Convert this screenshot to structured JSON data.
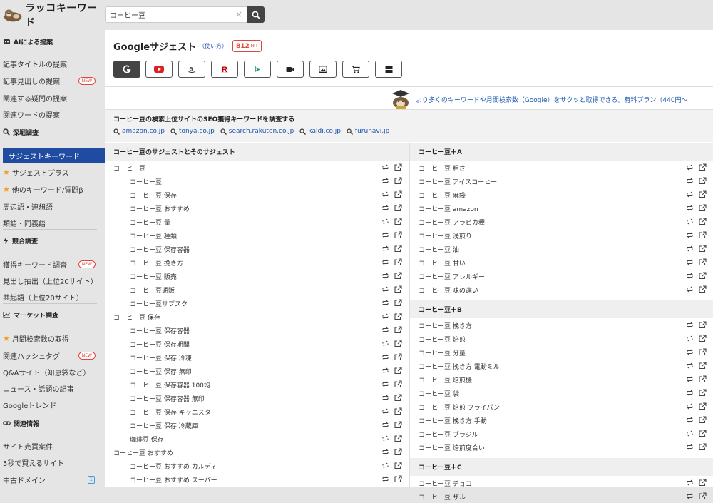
{
  "app": {
    "name": "ラッコキーワード"
  },
  "search": {
    "value": "コーヒー豆"
  },
  "sidebar": {
    "sections": [
      {
        "title": "AIによる提案",
        "icon": "robot-icon",
        "items": [
          {
            "label": "記事タイトルの提案"
          },
          {
            "label": "記事見出しの提案",
            "badge": "NEW"
          },
          {
            "label": "関連する疑問の提案"
          },
          {
            "label": "関連ワードの提案"
          }
        ]
      },
      {
        "title": "深堀調査",
        "icon": "search-icon",
        "items": [
          {
            "label": "サジェストキーワード",
            "active": true
          },
          {
            "label": "サジェストプラス",
            "star": true
          },
          {
            "label": "他のキーワード/質問β",
            "star": true
          },
          {
            "label": "周辺語・連想語"
          },
          {
            "label": "類語・同義語"
          }
        ]
      },
      {
        "title": "競合調査",
        "icon": "bolt-icon",
        "items": [
          {
            "label": "獲得キーワード調査",
            "badge": "NEW"
          },
          {
            "label": "見出し抽出（上位20サイト）"
          },
          {
            "label": "共起語（上位20サイト）"
          }
        ]
      },
      {
        "title": "マーケット調査",
        "icon": "chart-icon",
        "items": [
          {
            "label": "月間検索数の取得",
            "star": true
          },
          {
            "label": "関連ハッシュタグ",
            "badge": "NEW"
          },
          {
            "label": "Q&Aサイト（知恵袋など）"
          },
          {
            "label": "ニュース・話題の記事"
          },
          {
            "label": "Googleトレンド"
          }
        ]
      },
      {
        "title": "関連情報",
        "icon": "link-icon",
        "items": [
          {
            "label": "サイト売買案件"
          },
          {
            "label": "5秒で買えるサイト"
          },
          {
            "label": "中古ドメイン",
            "badge1": "1"
          }
        ]
      }
    ]
  },
  "main": {
    "title": "Googleサジェスト",
    "howto": "（使い方）",
    "hit_count": "812",
    "hit_unit": "HIT",
    "engines": [
      "google-icon",
      "youtube-icon",
      "amazon-icon",
      "rakuten-icon",
      "bing-icon",
      "video-icon",
      "image-icon",
      "shopping-icon",
      "news-icon"
    ],
    "promo": "より多くのキーワードや月間検索数（Google）をサクッと取得できる。有料プラン（440円〜",
    "seo_title": "コーヒー豆の検索上位サイトのSEO獲得キーワードを調査する",
    "seo_links": [
      "amazon.co.jp",
      "tonya.co.jp",
      "search.rakuten.co.jp",
      "kaldi.co.jp",
      "furunavi.jp"
    ],
    "left_header": "コーヒー豆のサジェストとそのサジェスト",
    "left_rows": [
      {
        "t": "コーヒー豆",
        "lvl": 0
      },
      {
        "t": "コーヒー豆",
        "lvl": 1
      },
      {
        "t": "コーヒー豆 保存",
        "lvl": 1
      },
      {
        "t": "コーヒー豆 おすすめ",
        "lvl": 1
      },
      {
        "t": "コーヒー豆 量",
        "lvl": 1
      },
      {
        "t": "コーヒー豆 種類",
        "lvl": 1
      },
      {
        "t": "コーヒー豆 保存容器",
        "lvl": 1
      },
      {
        "t": "コーヒー豆 挽き方",
        "lvl": 1
      },
      {
        "t": "コーヒー豆 販売",
        "lvl": 1
      },
      {
        "t": "コーヒー豆通販",
        "lvl": 1
      },
      {
        "t": "コーヒー豆サブスク",
        "lvl": 1
      },
      {
        "t": "コーヒー豆 保存",
        "lvl": 0
      },
      {
        "t": "コーヒー豆 保存容器",
        "lvl": 1
      },
      {
        "t": "コーヒー豆 保存期間",
        "lvl": 1
      },
      {
        "t": "コーヒー豆 保存 冷凍",
        "lvl": 1
      },
      {
        "t": "コーヒー豆 保存 無印",
        "lvl": 1
      },
      {
        "t": "コーヒー豆 保存容器 100均",
        "lvl": 1
      },
      {
        "t": "コーヒー豆 保存容器 無印",
        "lvl": 1
      },
      {
        "t": "コーヒー豆 保存 キャニスター",
        "lvl": 1
      },
      {
        "t": "コーヒー豆 保存 冷蔵庫",
        "lvl": 1
      },
      {
        "t": "珈琲豆 保存",
        "lvl": 1
      },
      {
        "t": "コーヒー豆 おすすめ",
        "lvl": 0
      },
      {
        "t": "コーヒー豆 おすすめ カルディ",
        "lvl": 1
      },
      {
        "t": "コーヒー豆 おすすめ スーパー",
        "lvl": 1
      }
    ],
    "right_groups": [
      {
        "header": "コーヒー豆＋A",
        "rows": [
          "コーヒー豆 粗さ",
          "コーヒー豆 アイスコーヒー",
          "コーヒー豆 麻袋",
          "コーヒー豆 amazon",
          "コーヒー豆 アラビカ種",
          "コーヒー豆 浅煎り",
          "コーヒー豆 油",
          "コーヒー豆 甘い",
          "コーヒー豆 アレルギー",
          "コーヒー豆 味の違い"
        ]
      },
      {
        "header": "コーヒー豆＋B",
        "rows": [
          "コーヒー豆 挽き方",
          "コーヒー豆 焙煎",
          "コーヒー豆 分量",
          "コーヒー豆 挽き方 電動ミル",
          "コーヒー豆 焙煎機",
          "コーヒー豆 袋",
          "コーヒー豆 焙煎 フライパン",
          "コーヒー豆 挽き方 手動",
          "コーヒー豆 ブラジル",
          "コーヒー豆 焙煎度合い"
        ]
      },
      {
        "header": "コーヒー豆＋C",
        "rows": [
          "コーヒー豆 チョコ",
          "コーヒー豆 ザル"
        ]
      }
    ]
  }
}
